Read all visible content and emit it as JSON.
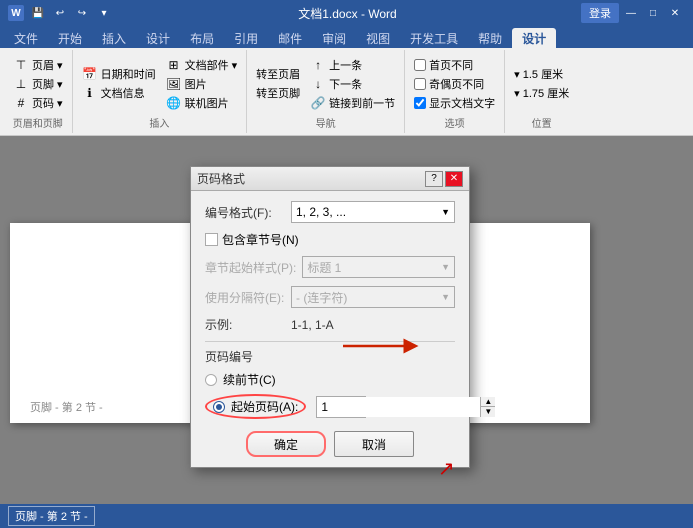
{
  "titleBar": {
    "title": "文档1.docx - Word",
    "appName": "Word",
    "undoLabel": "↩",
    "redoLabel": "↪",
    "saveLabel": "💾",
    "loginLabel": "登录",
    "minLabel": "—",
    "maxLabel": "□",
    "closeLabel": "✕",
    "quickAccessLabel": "▾"
  },
  "ribbonTabs": {
    "tabs": [
      "文件",
      "开始",
      "插入",
      "设计",
      "布局",
      "引用",
      "邮件",
      "审阅",
      "视图",
      "开发工具",
      "帮助",
      "设计"
    ],
    "activeTab": "设计"
  },
  "ribbon": {
    "groups": [
      {
        "name": "页眉页脚",
        "items": [
          "页眉▾",
          "页脚▾",
          "页码▾",
          "日期和时间",
          "文档信息",
          "图片",
          "联机图片",
          "文档部件▾"
        ]
      },
      {
        "name": "导航",
        "items": [
          "转至页眉",
          "转至页脚",
          "上一条",
          "下一条",
          "链接到前一节"
        ]
      },
      {
        "name": "选项",
        "items": [
          "首页不同",
          "奇偶页不同",
          "显示文档文字"
        ]
      },
      {
        "name": "位置",
        "items": [
          "1.5 厘米",
          "1.75 厘米"
        ]
      }
    ],
    "insertGroupLabel": "插入",
    "navGroupLabel": "导航",
    "optionsGroupLabel": "选项",
    "positionGroupLabel": "位置"
  },
  "dialog": {
    "title": "页码格式",
    "questionIcon": "?",
    "closeIcon": "✕",
    "formatLabel": "编号格式(F):",
    "formatValue": "1, 2, 3, ...",
    "includeChapterLabel": "包含章节号(N)",
    "chapterStyleLabel": "章节起始样式(P):",
    "chapterStyleValue": "标题 1",
    "separatorLabel": "使用分隔符(E):",
    "separatorValue": "- (连字符)",
    "exampleLabel": "示例:",
    "exampleValue": "1-1, 1-A",
    "pageNumberingLabel": "页码编号",
    "continueLabel": "续前节(C)",
    "startAtLabel": "起始页码(A):",
    "startAtValue": "1",
    "okLabel": "确定",
    "cancelLabel": "取消"
  },
  "docFooter": {
    "sectionLabel": "页脚 - 第 2 节 -"
  },
  "statusBar": {
    "items": []
  }
}
